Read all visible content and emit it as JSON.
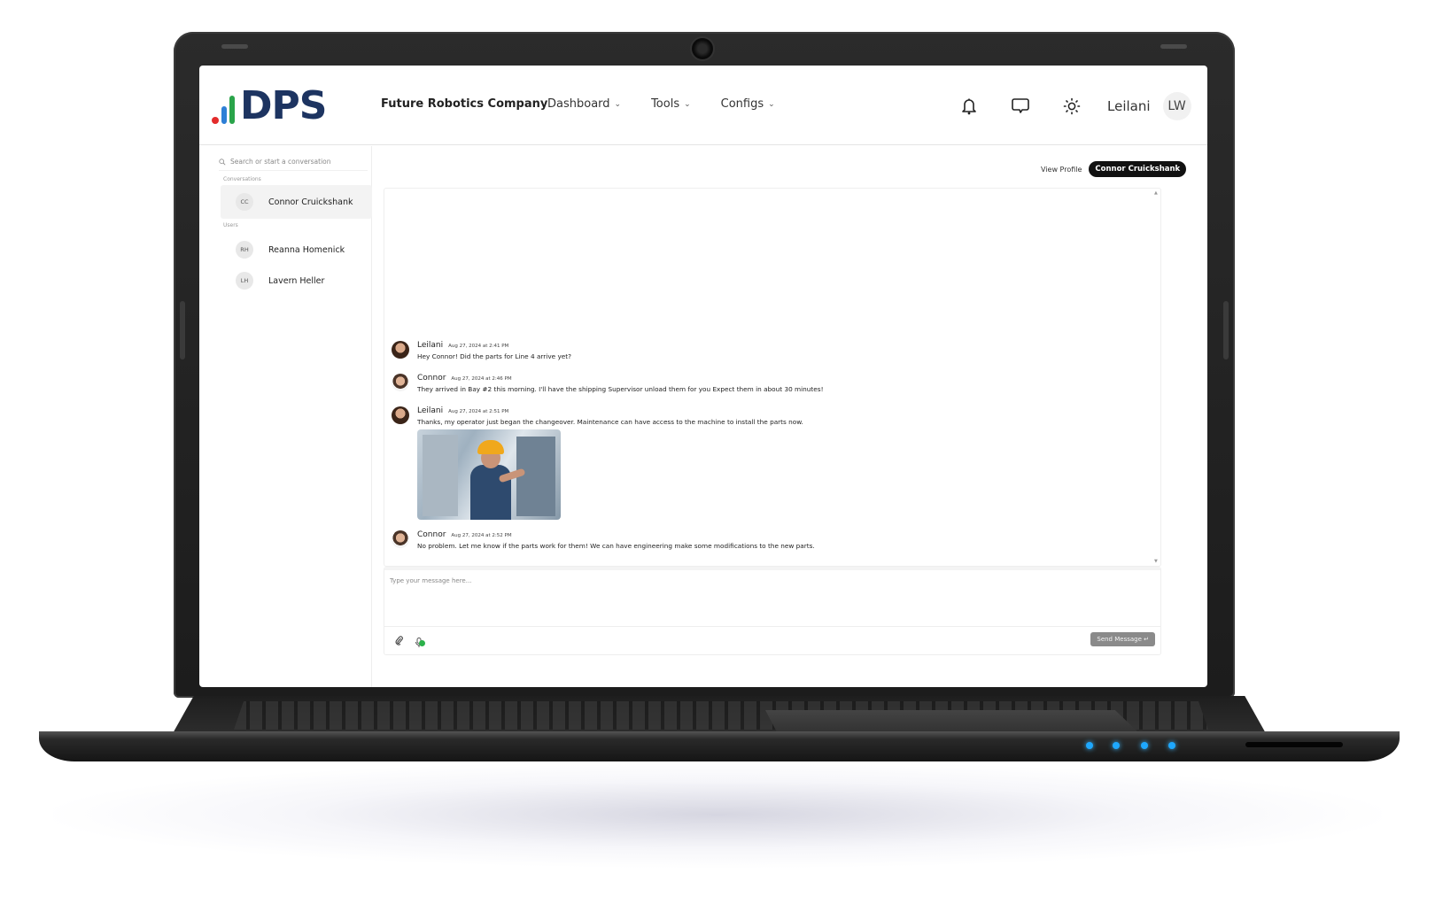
{
  "app": {
    "logo_text": "DPS",
    "company": "Future Robotics Company"
  },
  "nav": [
    {
      "label": "Dashboard",
      "icon": "chevron-down-icon"
    },
    {
      "label": "Tools",
      "icon": "chevron-down-icon"
    },
    {
      "label": "Configs",
      "icon": "chevron-down-icon"
    }
  ],
  "header": {
    "icons": [
      "bell-icon",
      "chat-bubble-icon",
      "sun-icon"
    ],
    "user_name": "Leilani",
    "user_initials": "LW"
  },
  "sidebar": {
    "search_placeholder": "Search or start a conversation",
    "conversations_label": "Conversations",
    "conversations": [
      {
        "initials": "CC",
        "name": "Connor Cruickshank",
        "active": true
      }
    ],
    "users_label": "Users",
    "users": [
      {
        "initials": "RH",
        "name": "Reanna Homenick"
      },
      {
        "initials": "LH",
        "name": "Lavern Heller"
      }
    ]
  },
  "chat": {
    "view_profile_label": "View Profile",
    "active_contact": "Connor Cruickshank",
    "messages": [
      {
        "sender": "Leilani",
        "time": "Aug 27, 2024 at 2:41 PM",
        "text": "Hey Connor! Did the parts for Line 4 arrive yet?"
      },
      {
        "sender": "Connor",
        "time": "Aug 27, 2024 at 2:46 PM",
        "text": "They arrived in Bay #2 this morning. I'll have the shipping Supervisor unload them for you Expect them in about 30 minutes!"
      },
      {
        "sender": "Leilani",
        "time": "Aug 27, 2024 at 2:51 PM",
        "text": "Thanks, my operator just began the changeover. Maintenance can have access to the machine to install the parts now.",
        "attachment": "photo of technician in hard hat working on machinery"
      },
      {
        "sender": "Connor",
        "time": "Aug 27, 2024 at 2:52 PM",
        "text": "No problem. Let me know if the parts work for them! We can have engineering make some modifications to the new parts."
      }
    ]
  },
  "composer": {
    "placeholder": "Type your message here...",
    "send_label": "Send Message ↵",
    "attach_icon": "paperclip-icon",
    "mic_icon": "microphone-icon",
    "mic_status_color": "#2bb14a"
  },
  "colors": {
    "brand_navy": "#1d3461",
    "logo_red": "#e32b2b",
    "logo_blue": "#2d7fd6",
    "logo_green": "#2aa44a",
    "pill_bg": "#111111",
    "send_button": "#8a8a8a",
    "laptop_led": "#1ea8ff"
  }
}
